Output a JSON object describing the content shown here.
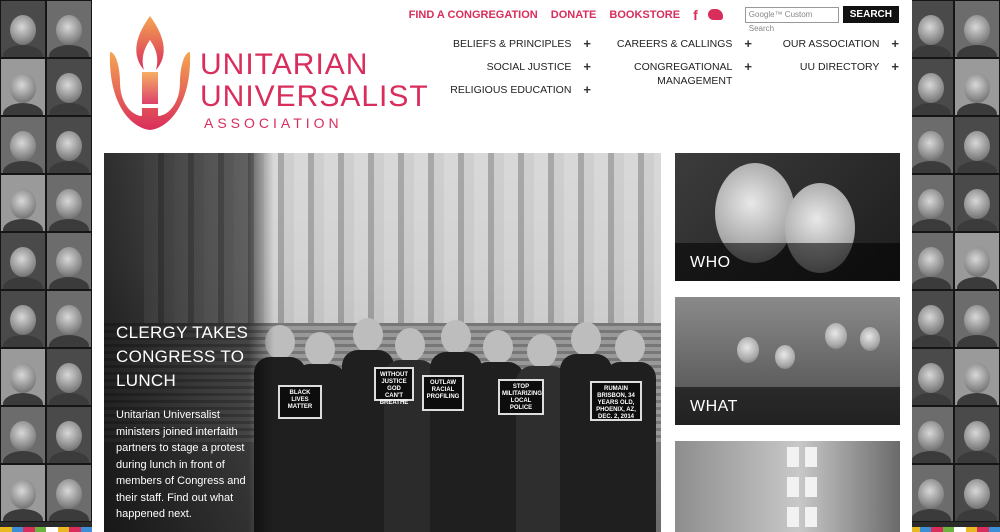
{
  "colors": {
    "brand": "#d92d5b",
    "brand_light": "#f0a54a",
    "nav_text": "#222222"
  },
  "logo": {
    "line1": "UNITARIAN",
    "line2": "UNIVERSALIST",
    "line3": "ASSOCIATION",
    "icon": "flaming-chalice-icon"
  },
  "utility": {
    "find_congregation": "FIND A CONGREGATION",
    "donate": "DONATE",
    "bookstore": "BOOKSTORE",
    "facebook_glyph": "f",
    "twitter_icon": "twitter-bird-icon",
    "search_placeholder": "Google™ Custom Search",
    "search_button": "SEARCH"
  },
  "nav": {
    "col1": [
      "BELIEFS & PRINCIPLES",
      "SOCIAL JUSTICE",
      "RELIGIOUS EDUCATION"
    ],
    "col2": [
      "CAREERS & CALLINGS",
      "CONGREGATIONAL\nMANAGEMENT"
    ],
    "col3": [
      "OUR ASSOCIATION",
      "UU DIRECTORY"
    ],
    "plus": "+"
  },
  "hero": {
    "title": "CLERGY TAKES CONGRESS TO LUNCH",
    "text": "Unitarian Universalist ministers joined interfaith partners to stage a protest during lunch in front of members of Congress and their staff. Find out what happened next.",
    "signs": [
      "BLACK LIVES MATTER",
      "WITHOUT JUSTICE GOD CAN'T BREATHE",
      "OUTLAW RACIAL PROFILING",
      "STOP MILITARIZING LOCAL POLICE",
      "RUMAIN BRISBON, 34 YEARS OLD, PHOENIX, AZ, DEC. 2, 2014"
    ]
  },
  "cards": [
    {
      "label": "WHO"
    },
    {
      "label": "WHAT"
    }
  ],
  "accent_strip": [
    "#e8b923",
    "#3c8fd6",
    "#d92d5b",
    "#6cb33f",
    "#ffffff",
    "#e8b923",
    "#d92d5b",
    "#3c8fd6"
  ]
}
